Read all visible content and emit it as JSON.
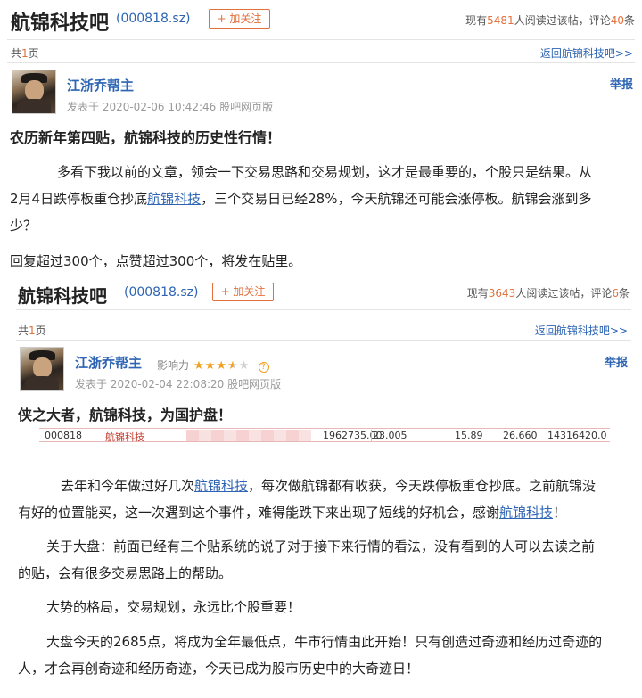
{
  "top": {
    "bar_name": "航锦科技吧",
    "code": "(000818.sz)",
    "follow_label": "+ 加关注",
    "stats_prefix": "现有",
    "readers": "5481",
    "stats_mid": "人阅读过该帖，评论",
    "comments": "40",
    "stats_suffix": "条",
    "page_prefix": "共",
    "pages": "1",
    "page_suffix": "页",
    "back_label": "返回航锦科技吧>>",
    "user": "江浙乔帮主",
    "report": "举报",
    "meta": "发表于 2020-02-06 10:42:46 股吧网页版",
    "title": "农历新年第四贴，航锦科技的历史性行情！",
    "p1_a": "多看下我以前的文章，领会一下交易思路和交易规划，这才是最重要的，个股只是结果。从",
    "p1_b_1": "2月4日跌停板重仓抄底",
    "p1_b_link": "航锦科技",
    "p1_b_2": "，三个交易日已经28%，今天航锦还可能会涨停板。航锦会涨到多",
    "p1_c": "少？",
    "p2": "回复超过300个，点赞超过300个，将发在贴里。"
  },
  "embedded": {
    "bar_name": "航锦科技吧",
    "code": "(000818.sz)",
    "follow_label": "+ 加关注",
    "stats_prefix": "现有",
    "readers": "3643",
    "stats_mid": "人阅读过该帖，评论",
    "comments": "6",
    "stats_suffix": "条",
    "page_prefix": "共",
    "pages": "1",
    "page_suffix": "页",
    "back_label": "返回航锦科技吧>>",
    "user": "江浙乔帮主",
    "influence_label": "影响力",
    "influence_rating": 3.5,
    "report": "举报",
    "meta": "发表于 2020-02-04 22:08:20 股吧网页版",
    "title": "侠之大者，航锦科技，为国护盘！",
    "ticker": {
      "code": "000818",
      "name": "航锦科技",
      "volume": "1962735.00",
      "price": "23.005",
      "v3": "15.89",
      "v4": "26.660",
      "amount": "14316420.0"
    },
    "para1_a_1": "去年和今年做过好几次",
    "para1_a_link": "航锦科技",
    "para1_a_2": "，每次做航锦都有收获，今天跌停板重仓抄底。之前航锦没",
    "para1_b_1": "有好的位置能买，这一次遇到这个事件，难得能跌下来出现了短线的好机会，感谢",
    "para1_b_link": "航锦科技",
    "para1_b_2": "！",
    "para2_a": "关于大盘：前面已经有三个贴系统的说了对于接下来行情的看法，没有看到的人可以去读之前",
    "para2_b": "的贴，会有很多交易思路上的帮助。",
    "para3": "大势的格局，交易规划，永远比个股重要！",
    "para4_a": "大盘今天的2685点，将成为全年最低点，牛市行情由此开始！只有创造过奇迹和经历过奇迹的",
    "para4_b": "人，才会再创奇迹和经历奇迹，今天已成为股市历史中的大奇迹日！"
  },
  "colors": {
    "accent": "#e2703a",
    "link": "#2d64b3",
    "star": "#f0a020"
  }
}
